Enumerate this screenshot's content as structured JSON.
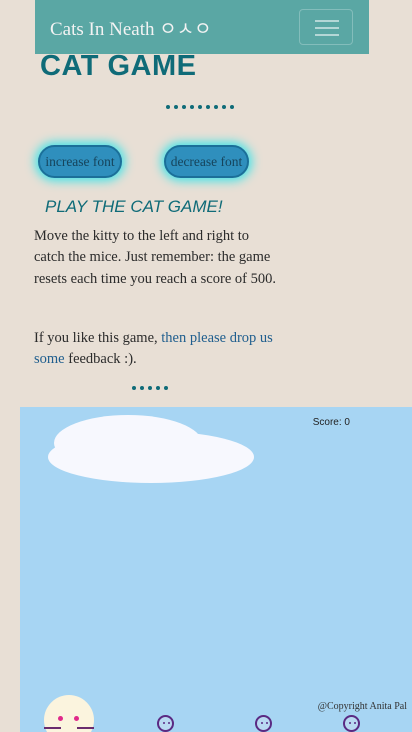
{
  "navbar": {
    "brand": "Cats In Neath ㅇㅅㅇ",
    "menu_icon": "hamburger-menu-icon"
  },
  "header": {
    "title": "CAT GAME"
  },
  "font_controls": {
    "increase_label": "increase font",
    "decrease_label": "decrease font"
  },
  "content": {
    "subtitle": "PLAY THE CAT GAME!",
    "instructions": "Move the kitty to the left and right to catch the mice. Just remember: the game resets each time you reach a score of 500.",
    "feedback_prefix": "If you like this game, ",
    "feedback_link": "then please drop us some",
    "feedback_suffix": " feedback :)."
  },
  "game": {
    "score_text": "Score: 0",
    "copyright": "@Copyright Anita Pal"
  },
  "colors": {
    "background": "#e8dfd5",
    "navbar": "#5aa7a4",
    "heading": "#0f6b78",
    "button": "#2f8fbd",
    "button_glow": "#43e3e8",
    "link": "#1f5e8e",
    "game_sky": "#a7d5f3",
    "cloud": "#f7f8fe"
  }
}
